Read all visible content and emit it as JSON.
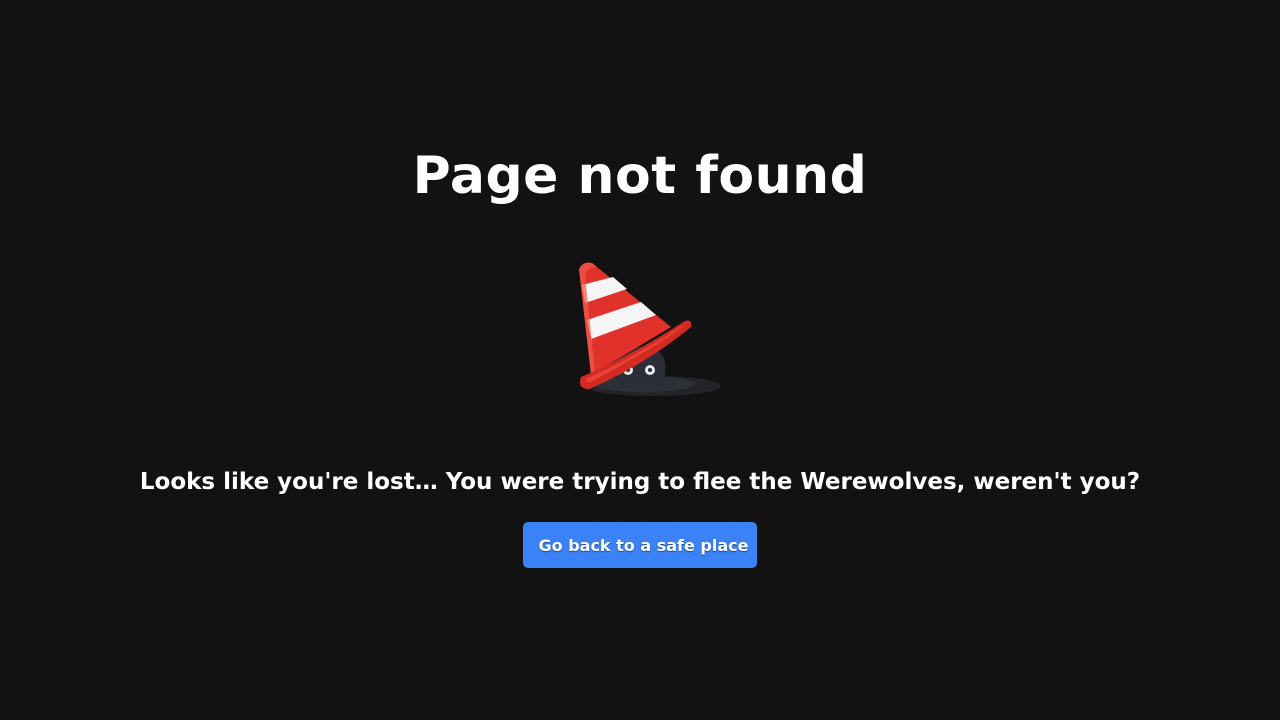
{
  "page": {
    "title": "Page not found",
    "message": "Looks like you're lost… You were trying to flee the Werewolves, weren't you?",
    "back_button": {
      "label": "Go back to a safe place",
      "icon": "running-person-icon"
    },
    "illustration": "traffic-cone-icon"
  },
  "colors": {
    "background": "#121212",
    "text": "#ffffff",
    "button": "#3b82f6",
    "cone_red": "#e0322a",
    "cone_stripe": "#f5f5f5",
    "creature": "#2b2e38"
  }
}
